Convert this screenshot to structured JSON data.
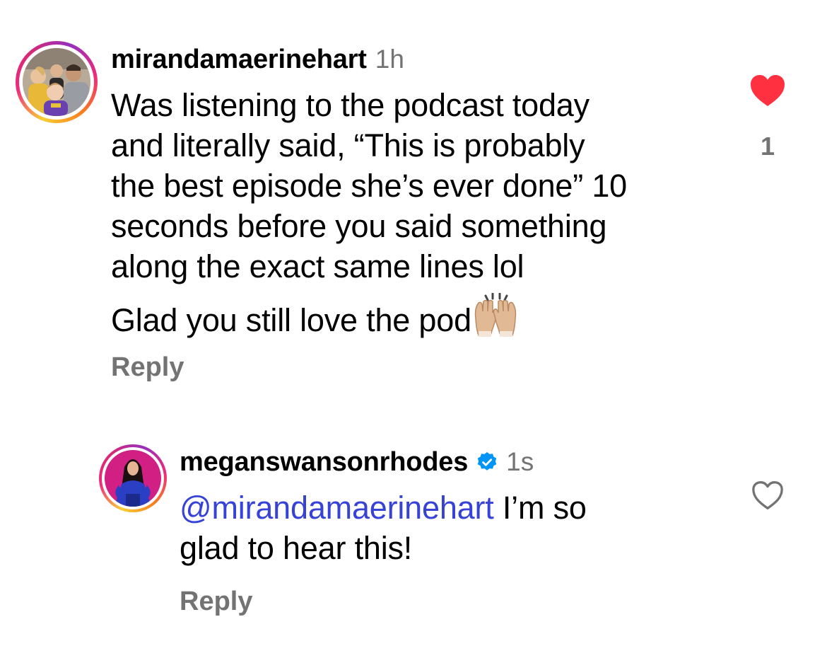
{
  "comments": [
    {
      "username": "mirandamaerinehart",
      "time": "1h",
      "lines": [
        "Was listening to the podcast today",
        "and literally said, “This is probably",
        "the best episode she’s ever done” 10",
        "seconds before you said something",
        "along the exact same lines lol"
      ],
      "last_line": "Glad you still love the pod",
      "emoji_icon": "raised-hands-icon",
      "reply_label": "Reply",
      "liked": true,
      "like_count": "1",
      "heart_color": "#ff3040"
    },
    {
      "username": "meganswansonrhodes",
      "verified": true,
      "time": "1s",
      "mention": "@mirandamaerinehart",
      "line1_rest": " I’m so",
      "line2": "glad to hear this!",
      "reply_label": "Reply",
      "liked": false,
      "mention_color": "#3742d6"
    }
  ]
}
